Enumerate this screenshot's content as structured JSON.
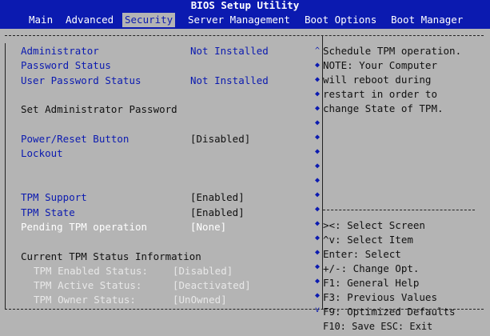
{
  "title": "BIOS Setup Utility",
  "menu": [
    {
      "label": "Main",
      "active": false
    },
    {
      "label": "Advanced",
      "active": false
    },
    {
      "label": "Security",
      "active": true
    },
    {
      "label": "Server Management",
      "active": false
    },
    {
      "label": "Boot Options",
      "active": false
    },
    {
      "label": "Boot Manager",
      "active": false
    }
  ],
  "settings": {
    "admin_label": "Administrator",
    "password_status_label": "Password Status",
    "admin_value": "Not Installed",
    "user_pw_label": "User Password Status",
    "user_pw_value": "Not Installed",
    "set_admin_pw": "Set Administrator Password",
    "power_reset_label": "Power/Reset Button",
    "power_reset_value": "[Disabled]",
    "lockout_label": "Lockout",
    "tpm_support_label": "TPM Support",
    "tpm_support_value": "[Enabled]",
    "tpm_state_label": "TPM State",
    "tpm_state_value": "[Enabled]",
    "pending_tpm_label": "Pending TPM operation",
    "pending_tpm_value": "[None]",
    "current_tpm_label": "Current TPM Status Information",
    "tpm_enabled_label": "TPM Enabled Status:",
    "tpm_enabled_value": "[Disabled]",
    "tpm_active_label": "TPM Active Status:",
    "tpm_active_value": "[Deactivated]",
    "tpm_owner_label": "TPM Owner Status:",
    "tpm_owner_value": "[UnOwned]"
  },
  "help": {
    "lines": [
      "Schedule TPM operation.",
      "NOTE: Your Computer",
      "will reboot during",
      "restart in order to",
      "change State of TPM."
    ],
    "keys": [
      "><: Select Screen",
      "^v: Select Item",
      "Enter: Select",
      "+/-: Change Opt.",
      "F1: General Help",
      "F3: Previous Values",
      "F9: Optimized Defaults",
      "F10: Save  ESC: Exit"
    ]
  },
  "colors": {
    "header_bg": "#0b1ab0",
    "body_bg": "#b4b4b4",
    "selected_text": "#ffffff"
  }
}
